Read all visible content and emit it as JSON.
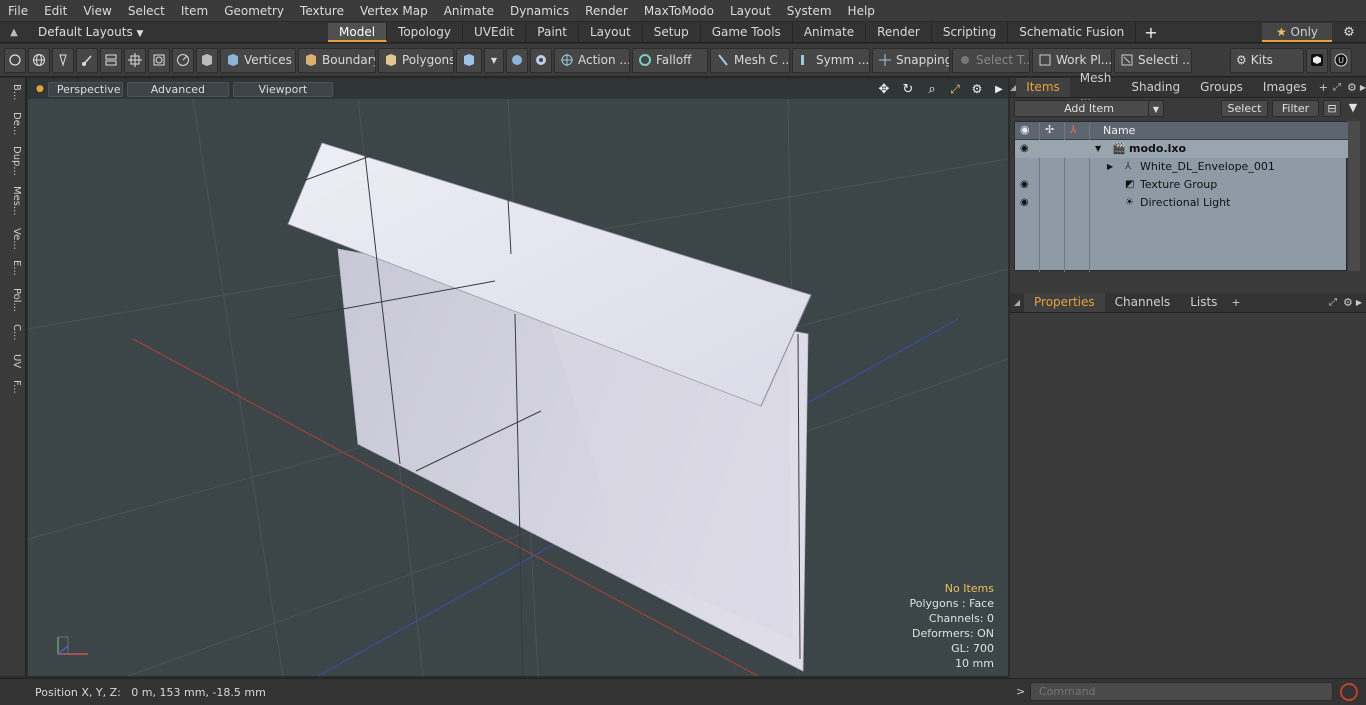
{
  "menu": [
    "File",
    "Edit",
    "View",
    "Select",
    "Item",
    "Geometry",
    "Texture",
    "Vertex Map",
    "Animate",
    "Dynamics",
    "Render",
    "MaxToModo",
    "Layout",
    "System",
    "Help"
  ],
  "layout": {
    "selector": "Default Layouts",
    "tabs": [
      "Model",
      "Topology",
      "UVEdit",
      "Paint",
      "Layout",
      "Setup",
      "Game Tools",
      "Animate",
      "Render",
      "Scripting",
      "Schematic Fusion"
    ],
    "active_tab": "Model",
    "only_label": "Only"
  },
  "toolbar": {
    "vertices": "Vertices",
    "boundary": "Boundary",
    "polygons": "Polygons",
    "action": "Action ...",
    "falloff": "Falloff",
    "mesh": "Mesh C ...",
    "symm": "Symm ...",
    "snapping": "Snapping",
    "select_t": "Select T...",
    "work_pl": "Work Pl...",
    "selecti": "Selecti ...",
    "kits": "Kits"
  },
  "left_tabs": [
    "B...",
    "De...",
    "Dup...",
    "Mes...",
    "Ve...",
    "E...",
    "Pol...",
    "C...",
    "UV",
    "F..."
  ],
  "viewport": {
    "perspective": "Perspective",
    "advanced": "Advanced",
    "textures": "Viewport Textures",
    "stats": {
      "no_items": "No Items",
      "polygons": "Polygons : Face",
      "channels": "Channels: 0",
      "deformers": "Deformers: ON",
      "gl": "GL: 700",
      "scale": "10 mm"
    }
  },
  "status": {
    "position": "Position X, Y, Z:   0 m, 153 mm, -18.5 mm"
  },
  "items_panel": {
    "tabs": [
      "Items",
      "Mesh ...",
      "Shading",
      "Groups",
      "Images"
    ],
    "add_item": "Add Item",
    "select": "Select",
    "filter": "Filter",
    "name_header": "Name",
    "rows": [
      {
        "label": "modo.lxo",
        "bold": true
      },
      {
        "label": "White_DL_Envelope_001",
        "bold": false
      },
      {
        "label": "Texture Group",
        "bold": false
      },
      {
        "label": "Directional Light",
        "bold": false
      }
    ]
  },
  "properties_panel": {
    "tabs": [
      "Properties",
      "Channels",
      "Lists"
    ]
  },
  "command": {
    "placeholder": "Command"
  },
  "colors": {
    "accent": "#e8a13a",
    "viewport_bg": "#3c4548",
    "list_bg": "#8e9ba6"
  }
}
